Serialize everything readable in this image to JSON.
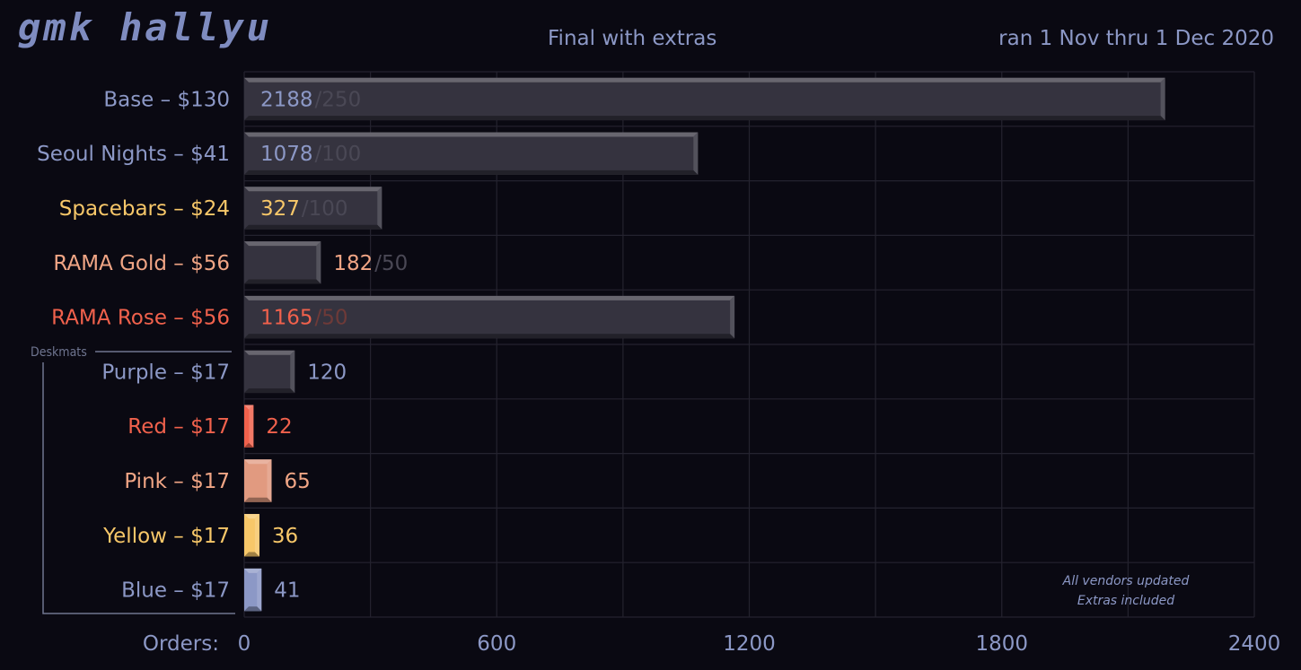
{
  "header": {
    "title": "gmk hallyu",
    "subtitle": "Final with extras",
    "date_range": "ran 1 Nov thru 1 Dec 2020"
  },
  "colors": {
    "background": "#0a0912",
    "grid": "#24232f",
    "bar_dark": "#35333f",
    "blue_text": "#8c98c6",
    "yellow": "#f7c769",
    "peach": "#f0a585",
    "coral": "#f0614c",
    "muted_target": "#4a4855"
  },
  "chart_data": {
    "type": "bar",
    "orientation": "horizontal",
    "xlabel": "Orders:",
    "xlim": [
      0,
      2400
    ],
    "xticks": [
      0,
      600,
      1200,
      1800,
      2400
    ],
    "grid": true,
    "group_label": "Deskmats",
    "note_lines": [
      "All vendors updated",
      "Extras included"
    ],
    "items": [
      {
        "label": "Base – $130",
        "value": 2188,
        "target": 250,
        "target_text": "/250",
        "label_color": "#8c98c6",
        "value_color": "#8c98c6",
        "bar_color": "#35333f"
      },
      {
        "label": "Seoul Nights – $41",
        "value": 1078,
        "target": 100,
        "target_text": "/100",
        "label_color": "#8c98c6",
        "value_color": "#8c98c6",
        "bar_color": "#35333f"
      },
      {
        "label": "Spacebars – $24",
        "value": 327,
        "target": 100,
        "target_text": "/100",
        "label_color": "#f7c769",
        "value_color": "#f7c769",
        "bar_color": "#35333f"
      },
      {
        "label": "RAMA Gold – $56",
        "value": 182,
        "target": 50,
        "target_text": "/50",
        "label_color": "#f0a585",
        "value_color": "#f0a585",
        "bar_color": "#35333f"
      },
      {
        "label": "RAMA Rose – $56",
        "value": 1165,
        "target": 50,
        "target_text": "/50",
        "label_color": "#f0614c",
        "value_color": "#f0614c",
        "bar_color": "#35333f"
      },
      {
        "label": "Purple – $17",
        "value": 120,
        "label_color": "#8c98c6",
        "value_color": "#8c98c6",
        "bar_color": "#35333f",
        "group": "Deskmats"
      },
      {
        "label": "Red – $17",
        "value": 22,
        "label_color": "#f0614c",
        "value_color": "#f0614c",
        "bar_color": "#f0614c",
        "group": "Deskmats"
      },
      {
        "label": "Pink – $17",
        "value": 65,
        "label_color": "#f0a585",
        "value_color": "#f0a585",
        "bar_color": "#e19a80",
        "group": "Deskmats"
      },
      {
        "label": "Yellow – $17",
        "value": 36,
        "label_color": "#f7c769",
        "value_color": "#f7c769",
        "bar_color": "#f7c769",
        "group": "Deskmats"
      },
      {
        "label": "Blue – $17",
        "value": 41,
        "label_color": "#8c98c6",
        "value_color": "#8c98c6",
        "bar_color": "#8c98c6",
        "group": "Deskmats"
      }
    ]
  }
}
